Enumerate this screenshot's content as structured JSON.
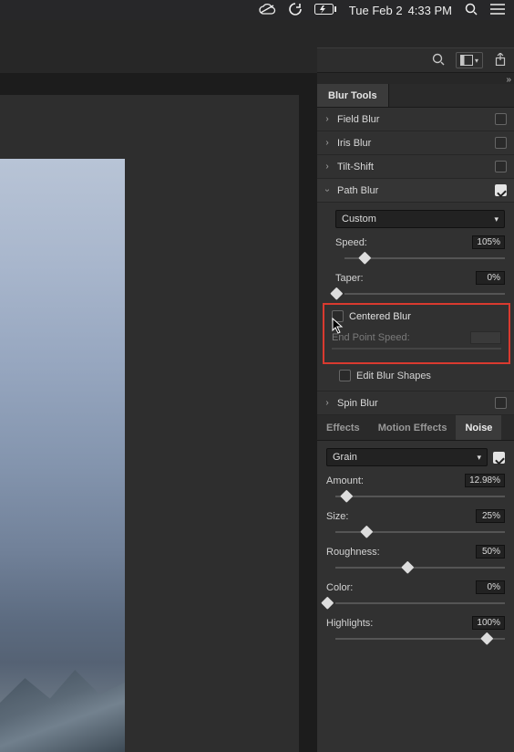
{
  "menubar": {
    "date": "Tue Feb 2",
    "time": "4:33 PM"
  },
  "panel": {
    "title_tab": "Blur Tools",
    "field_blur": "Field Blur",
    "iris_blur": "Iris Blur",
    "tilt_shift": "Tilt-Shift",
    "path_blur": "Path Blur",
    "spin_blur": "Spin Blur",
    "path": {
      "preset": "Custom",
      "speed_label": "Speed:",
      "speed_value": "105%",
      "taper_label": "Taper:",
      "taper_value": "0%",
      "centered_label": "Centered Blur",
      "endpoint_label": "End Point Speed:",
      "edit_shapes": "Edit Blur Shapes"
    },
    "subtabs": {
      "effects": "Effects",
      "motion": "Motion Effects",
      "noise": "Noise"
    },
    "noise": {
      "preset": "Grain",
      "amount_label": "Amount:",
      "amount_value": "12.98%",
      "size_label": "Size:",
      "size_value": "25%",
      "rough_label": "Roughness:",
      "rough_value": "50%",
      "color_label": "Color:",
      "color_value": "0%",
      "hl_label": "Highlights:",
      "hl_value": "100%"
    }
  }
}
